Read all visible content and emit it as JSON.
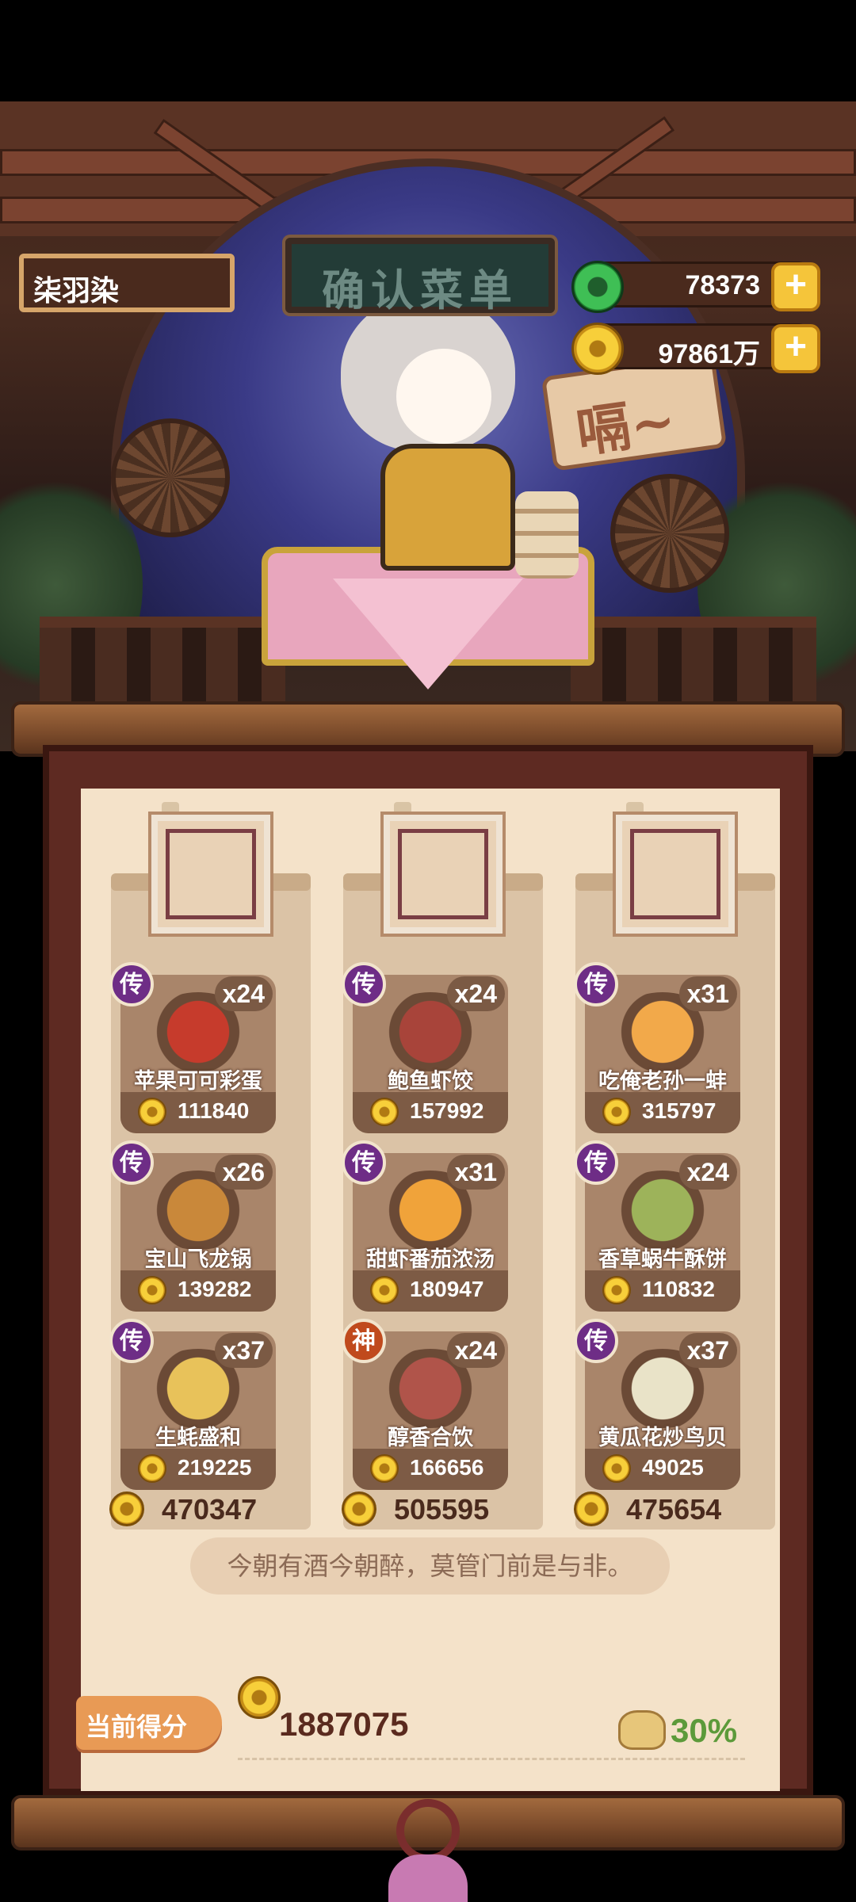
{
  "player": {
    "name": "柒羽染"
  },
  "title_plaque": "确认菜单",
  "sign_text": "嗝~",
  "currency": {
    "jade": {
      "value": "78373",
      "icon": "jade-coin-icon"
    },
    "coins": {
      "value": "97861万",
      "icon": "copper-coin-icon"
    },
    "plus_label": "+"
  },
  "columns": [
    {
      "portrait": "green-haired-customer-portrait",
      "dishes": [
        {
          "badge": "传",
          "qty": "x24",
          "name": "苹果可可彩蛋",
          "price": "111840",
          "food_color": "#c63b2c"
        },
        {
          "badge": "传",
          "qty": "x26",
          "name": "宝山飞龙锅",
          "price": "139282",
          "food_color": "#c9883a"
        },
        {
          "badge": "传",
          "qty": "x37",
          "name": "生蚝盛和",
          "price": "219225",
          "food_color": "#e8c25a"
        }
      ],
      "total": "470347"
    },
    {
      "portrait": "crowned-customer-portrait",
      "dishes": [
        {
          "badge": "传",
          "qty": "x24",
          "name": "鲍鱼虾饺",
          "price": "157992",
          "food_color": "#a8443a"
        },
        {
          "badge": "传",
          "qty": "x31",
          "name": "甜虾番茄浓汤",
          "price": "180947",
          "food_color": "#f0a33a"
        },
        {
          "badge": "神",
          "qty": "x24",
          "name": "醇香合饮",
          "price": "166656",
          "food_color": "#b0544a"
        }
      ],
      "total": "505595"
    },
    {
      "portrait": "pink-haired-customer-portrait",
      "dishes": [
        {
          "badge": "传",
          "qty": "x31",
          "name": "吃俺老孙一蚌",
          "price": "315797",
          "food_color": "#f2a94a"
        },
        {
          "badge": "传",
          "qty": "x24",
          "name": "香草蜗牛酥饼",
          "price": "110832",
          "food_color": "#9db35a"
        },
        {
          "badge": "传",
          "qty": "x37",
          "name": "黄瓜花炒鸟贝",
          "price": "49025",
          "food_color": "#e9e3c8"
        }
      ],
      "total": "475654"
    }
  ],
  "motto": "今朝有酒今朝醉，莫管门前是与非。",
  "score": {
    "button_label": "当前得分",
    "value": "1887075",
    "bonus": "30%"
  },
  "colors": {
    "badge_legendary": "#6e2d86",
    "badge_divine": "#c04a1d",
    "bonus_green": "#5c9a3a"
  }
}
